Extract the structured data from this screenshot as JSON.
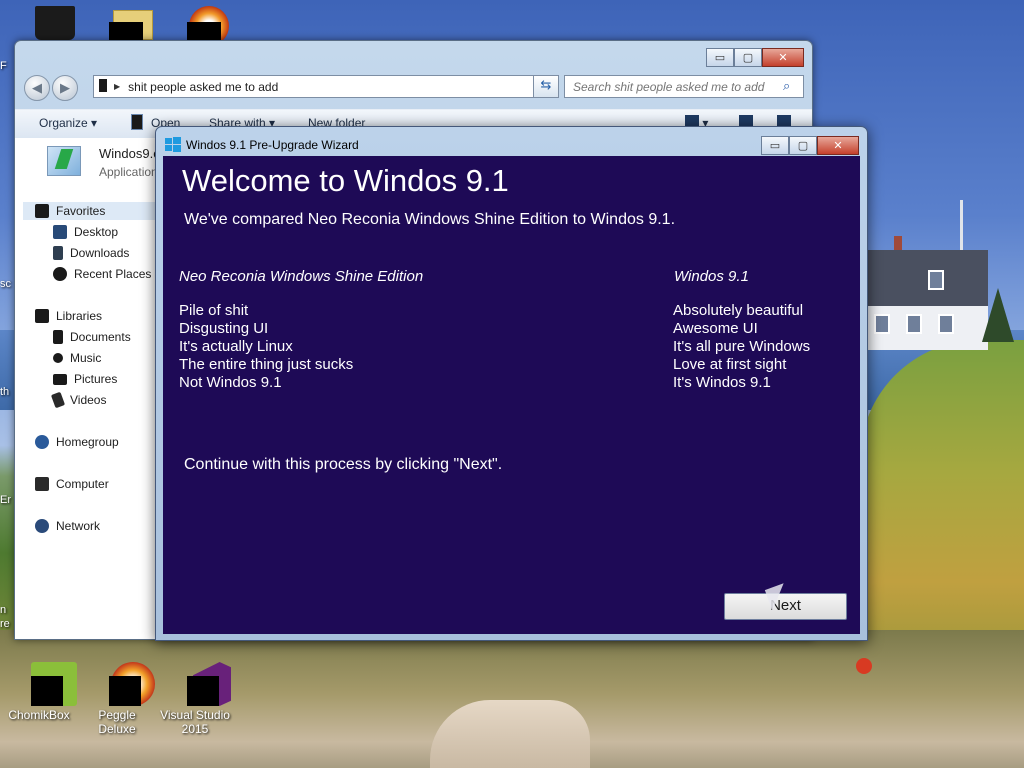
{
  "desktop": {
    "icons_top": [
      {
        "label": ""
      },
      {
        "label": ""
      },
      {
        "label": ""
      }
    ],
    "icons_bottom": [
      {
        "label": "ChomikBox"
      },
      {
        "label": "Peggle Deluxe"
      },
      {
        "label": "Visual Studio 2015"
      }
    ],
    "edge_fragments": [
      "F",
      "sc",
      "th",
      "Er",
      "n",
      "re"
    ]
  },
  "explorer": {
    "caption_buttons": {
      "minimize": "▭",
      "maximize": "▢",
      "close": "✕"
    },
    "address": {
      "path": "shit people asked me to add"
    },
    "search": {
      "placeholder": "Search shit people asked me to add"
    },
    "toolbar": {
      "organize": "Organize ▾",
      "open": "Open",
      "share_with": "Share with ▾",
      "new_folder": "New folder"
    },
    "file_header": {
      "name": "Windos9.e",
      "type": "Application"
    },
    "nav": {
      "favorites": "Favorites",
      "desktop": "Desktop",
      "downloads": "Downloads",
      "recent": "Recent Places",
      "libraries": "Libraries",
      "documents": "Documents",
      "music": "Music",
      "pictures": "Pictures",
      "videos": "Videos",
      "homegroup": "Homegroup",
      "computer": "Computer",
      "network": "Network"
    }
  },
  "wizard": {
    "title": "Windos 9.1 Pre-Upgrade Wizard",
    "heading": "Welcome to Windos 9.1",
    "subheading": "We've compared Neo Reconia Windows Shine Edition  to Windos 9.1.",
    "left_header": "Neo Reconia Windows Shine Edition",
    "right_header": "Windos 9.1",
    "left_items": [
      "Pile of shit",
      "Disgusting UI",
      "It's actually Linux",
      "The entire thing just sucks",
      "Not Windos 9.1"
    ],
    "right_items": [
      "Absolutely beautiful",
      "Awesome UI",
      "It's all pure Windows",
      "Love at first sight",
      "It's Windos 9.1"
    ],
    "continue_text": "Continue with this process by clicking \"Next\".",
    "next_label": "Next",
    "content_bg": "#1e0a56"
  }
}
